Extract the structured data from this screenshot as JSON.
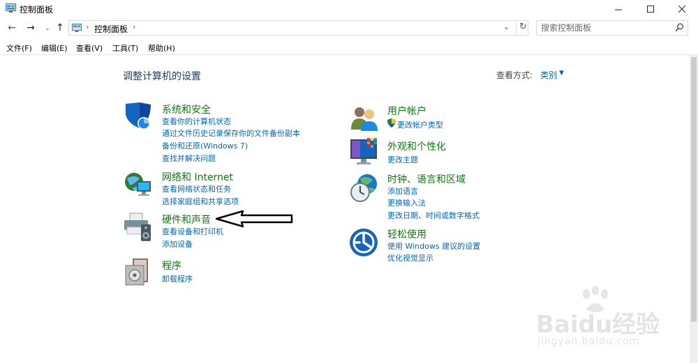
{
  "window": {
    "title": "控制面板"
  },
  "address": {
    "path": "控制面板"
  },
  "search": {
    "placeholder": "搜索控制面板"
  },
  "menu": [
    "文件(F)",
    "编辑(E)",
    "查看(V)",
    "工具(T)",
    "帮助(H)"
  ],
  "content": {
    "heading": "调整计算机的设置",
    "view_by_label": "查看方式:",
    "view_by_value": "类别"
  },
  "categories": [
    {
      "title": "系统和安全",
      "links": [
        "查看你的计算机状态",
        "通过文件历史记录保存你的文件备份副本",
        "备份和还原(Windows 7)",
        "查找并解决问题"
      ],
      "icon": "shield-icon"
    },
    {
      "title": "网络和 Internet",
      "links": [
        "查看网络状态和任务",
        "选择家庭组和共享选项"
      ],
      "icon": "network-globe-icon"
    },
    {
      "title": "硬件和声音",
      "links": [
        "查看设备和打印机",
        "添加设备"
      ],
      "icon": "printer-speaker-icon"
    },
    {
      "title": "程序",
      "links": [
        "卸载程序"
      ],
      "icon": "programs-icon"
    },
    {
      "title": "用户帐户",
      "links": [
        "更改帐户类型"
      ],
      "icon": "users-icon"
    },
    {
      "title": "外观和个性化",
      "links": [
        "更改主题"
      ],
      "icon": "monitor-color-icon"
    },
    {
      "title": "时钟、语言和区域",
      "links": [
        "添加语言",
        "更换输入法",
        "更改日期、时间或数字格式"
      ],
      "icon": "clock-globe-icon"
    },
    {
      "title": "轻松使用",
      "links": [
        "使用 Windows 建议的设置",
        "优化视觉显示"
      ],
      "icon": "ease-of-access-icon"
    }
  ],
  "watermark": {
    "text_main": "Baidu经验",
    "text_sub": "jingyan.baidu.com"
  },
  "colors": {
    "link": "#0066cc",
    "category_title": "#0f7b0f",
    "heading": "#1e395b"
  }
}
